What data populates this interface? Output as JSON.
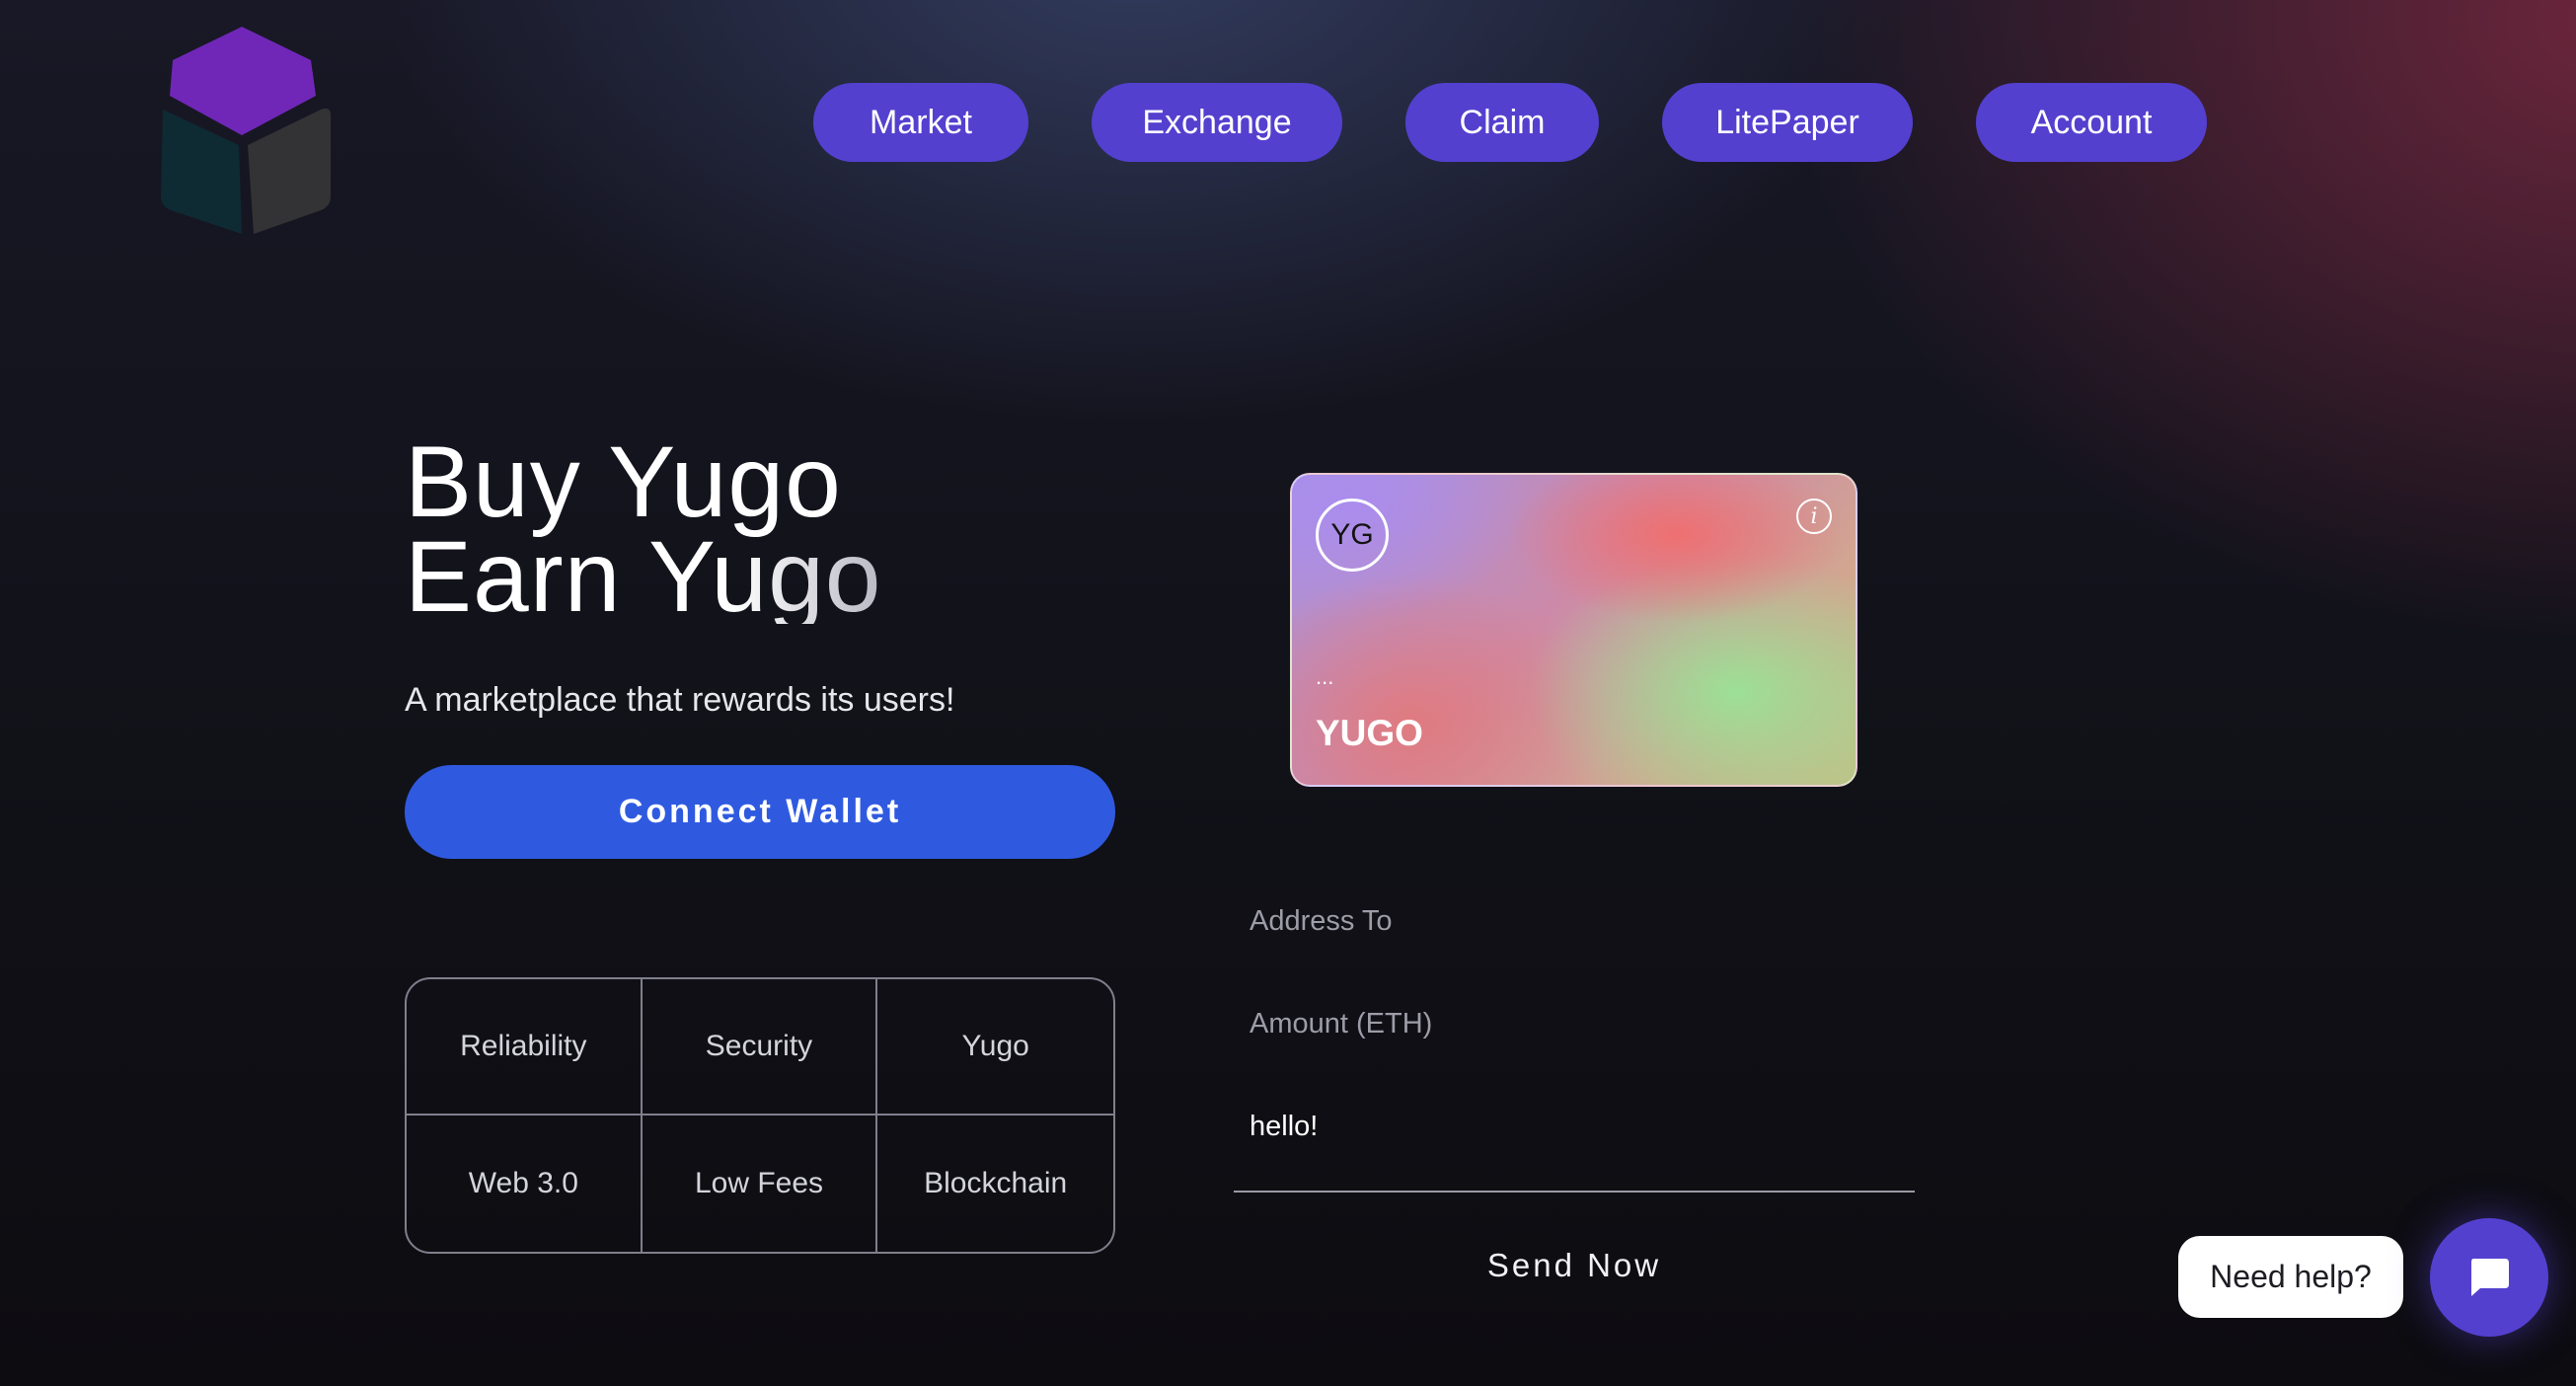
{
  "nav": {
    "market": "Market",
    "exchange": "Exchange",
    "claim": "Claim",
    "litepaper": "LitePaper",
    "account": "Account"
  },
  "hero": {
    "line1": "Buy Yugo",
    "line2": "Earn Yugo",
    "tagline": "A marketplace that rewards its users!",
    "connect_label": "Connect Wallet"
  },
  "features": [
    "Reliability",
    "Security",
    "Yugo",
    "Web 3.0",
    "Low Fees",
    "Blockchain"
  ],
  "card": {
    "avatar": "YG",
    "info_icon": "info-icon",
    "address_placeholder": "...",
    "ticker": "YUGO"
  },
  "form": {
    "address_placeholder": "Address To",
    "amount_placeholder": "Amount (ETH)",
    "message_value": "hello!",
    "send_label": "Send Now"
  },
  "help": {
    "label": "Need help?",
    "chat_icon": "chat-bubble-icon"
  },
  "colors": {
    "nav_pill": "#5340cf",
    "connect_button": "#2f5ae0",
    "logo_top": "#7027b8",
    "logo_left": "#0e2a33",
    "logo_right": "#333335"
  }
}
